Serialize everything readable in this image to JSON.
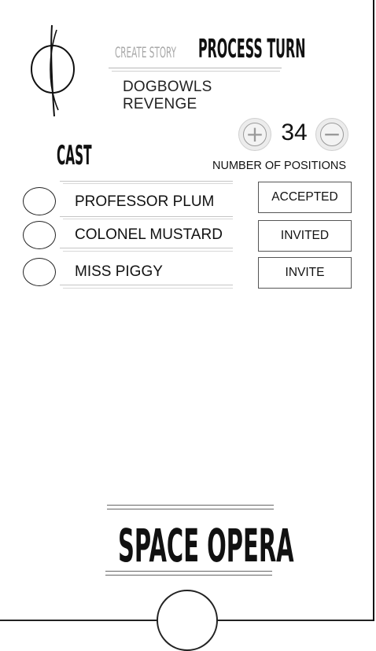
{
  "nav": {
    "create_story": "CREATE STORY",
    "process_turn": "PROCESS TURN"
  },
  "story": {
    "title": "DOGBOWLS REVENGE"
  },
  "cast": {
    "title": "CAST",
    "positions_label": "NUMBER OF POSITIONS",
    "positions_value": "34",
    "increment_icon": "plus-icon",
    "decrement_icon": "minus-icon",
    "members": [
      {
        "name": "PROFESSOR PLUM",
        "status": "ACCEPTED"
      },
      {
        "name": "COLONEL MUSTARD",
        "status": "INVITED"
      },
      {
        "name": "MISS PIGGY",
        "status": "INVITE"
      }
    ]
  },
  "brand": {
    "name": "SPACE OPERA"
  },
  "colors": {
    "inactive_nav": "#a8a8a8",
    "text": "#111111",
    "stepper_bg": "#ececec"
  }
}
